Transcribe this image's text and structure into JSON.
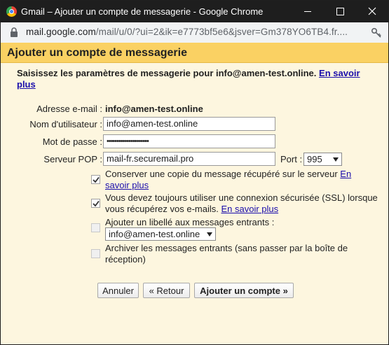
{
  "window": {
    "title": "Gmail – Ajouter un compte de messagerie - Google Chrome"
  },
  "addressbar": {
    "host": "mail.google.com",
    "path": "/mail/u/0/?ui=2&ik=e7773bf5e6&jsver=Gm378YO6TB4.fr...."
  },
  "dialog": {
    "title": "Ajouter un compte de messagerie",
    "intro": "Saisissez les paramètres de messagerie pour info@amen-test.online.",
    "intro_link": "En savoir plus",
    "email_label": "Adresse e-mail :",
    "email_value": "info@amen-test.online",
    "username_label": "Nom d'utilisateur :",
    "username_value": "info@amen-test.online",
    "password_label": "Mot de passe :",
    "password_value": "•••••••••••••••••••••",
    "pop_label": "Serveur POP :",
    "pop_value": "mail-fr.securemail.pro",
    "port_label": "Port :",
    "port_value": "995",
    "options": [
      {
        "text": "Conserver une copie du message récupéré sur le serveur",
        "link": "En savoir plus",
        "checked": true
      },
      {
        "text": "Vous devez toujours utiliser une connexion sécurisée (SSL) lorsque vous récupérez vos e-mails.",
        "link": "En savoir plus",
        "checked": true
      },
      {
        "text": "Ajouter un libellé aux messages entrants :",
        "checked": false,
        "select_value": "info@amen-test.online"
      },
      {
        "text": "Archiver les messages entrants (sans passer par la boîte de réception)",
        "checked": false
      }
    ],
    "buttons": {
      "cancel": "Annuler",
      "back": "« Retour",
      "add": "Ajouter un compte »"
    }
  }
}
